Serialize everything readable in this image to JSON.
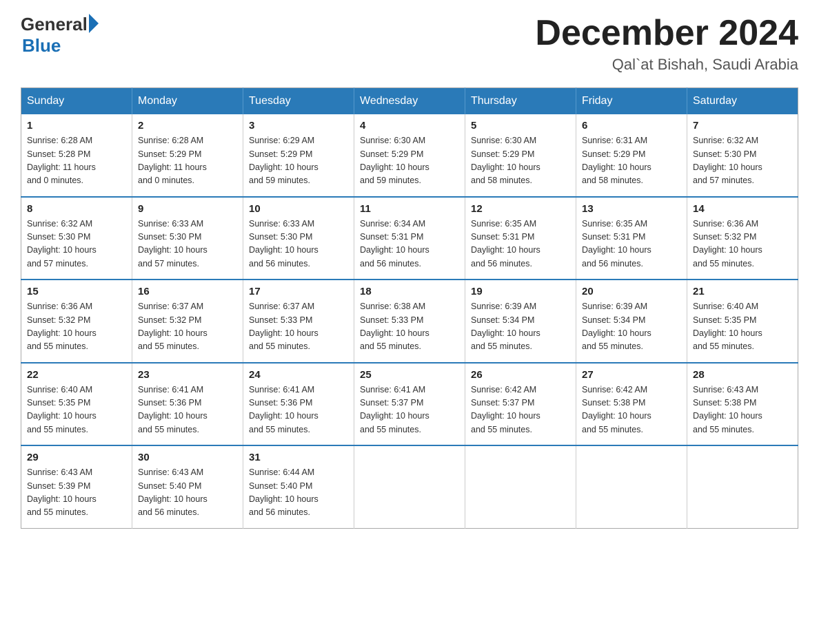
{
  "header": {
    "logo_general": "General",
    "logo_blue": "Blue",
    "month_title": "December 2024",
    "location": "Qal`at Bishah, Saudi Arabia"
  },
  "days_of_week": [
    "Sunday",
    "Monday",
    "Tuesday",
    "Wednesday",
    "Thursday",
    "Friday",
    "Saturday"
  ],
  "weeks": [
    [
      {
        "day": "1",
        "sunrise": "6:28 AM",
        "sunset": "5:28 PM",
        "daylight": "11 hours and 0 minutes."
      },
      {
        "day": "2",
        "sunrise": "6:28 AM",
        "sunset": "5:29 PM",
        "daylight": "11 hours and 0 minutes."
      },
      {
        "day": "3",
        "sunrise": "6:29 AM",
        "sunset": "5:29 PM",
        "daylight": "10 hours and 59 minutes."
      },
      {
        "day": "4",
        "sunrise": "6:30 AM",
        "sunset": "5:29 PM",
        "daylight": "10 hours and 59 minutes."
      },
      {
        "day": "5",
        "sunrise": "6:30 AM",
        "sunset": "5:29 PM",
        "daylight": "10 hours and 58 minutes."
      },
      {
        "day": "6",
        "sunrise": "6:31 AM",
        "sunset": "5:29 PM",
        "daylight": "10 hours and 58 minutes."
      },
      {
        "day": "7",
        "sunrise": "6:32 AM",
        "sunset": "5:30 PM",
        "daylight": "10 hours and 57 minutes."
      }
    ],
    [
      {
        "day": "8",
        "sunrise": "6:32 AM",
        "sunset": "5:30 PM",
        "daylight": "10 hours and 57 minutes."
      },
      {
        "day": "9",
        "sunrise": "6:33 AM",
        "sunset": "5:30 PM",
        "daylight": "10 hours and 57 minutes."
      },
      {
        "day": "10",
        "sunrise": "6:33 AM",
        "sunset": "5:30 PM",
        "daylight": "10 hours and 56 minutes."
      },
      {
        "day": "11",
        "sunrise": "6:34 AM",
        "sunset": "5:31 PM",
        "daylight": "10 hours and 56 minutes."
      },
      {
        "day": "12",
        "sunrise": "6:35 AM",
        "sunset": "5:31 PM",
        "daylight": "10 hours and 56 minutes."
      },
      {
        "day": "13",
        "sunrise": "6:35 AM",
        "sunset": "5:31 PM",
        "daylight": "10 hours and 56 minutes."
      },
      {
        "day": "14",
        "sunrise": "6:36 AM",
        "sunset": "5:32 PM",
        "daylight": "10 hours and 55 minutes."
      }
    ],
    [
      {
        "day": "15",
        "sunrise": "6:36 AM",
        "sunset": "5:32 PM",
        "daylight": "10 hours and 55 minutes."
      },
      {
        "day": "16",
        "sunrise": "6:37 AM",
        "sunset": "5:32 PM",
        "daylight": "10 hours and 55 minutes."
      },
      {
        "day": "17",
        "sunrise": "6:37 AM",
        "sunset": "5:33 PM",
        "daylight": "10 hours and 55 minutes."
      },
      {
        "day": "18",
        "sunrise": "6:38 AM",
        "sunset": "5:33 PM",
        "daylight": "10 hours and 55 minutes."
      },
      {
        "day": "19",
        "sunrise": "6:39 AM",
        "sunset": "5:34 PM",
        "daylight": "10 hours and 55 minutes."
      },
      {
        "day": "20",
        "sunrise": "6:39 AM",
        "sunset": "5:34 PM",
        "daylight": "10 hours and 55 minutes."
      },
      {
        "day": "21",
        "sunrise": "6:40 AM",
        "sunset": "5:35 PM",
        "daylight": "10 hours and 55 minutes."
      }
    ],
    [
      {
        "day": "22",
        "sunrise": "6:40 AM",
        "sunset": "5:35 PM",
        "daylight": "10 hours and 55 minutes."
      },
      {
        "day": "23",
        "sunrise": "6:41 AM",
        "sunset": "5:36 PM",
        "daylight": "10 hours and 55 minutes."
      },
      {
        "day": "24",
        "sunrise": "6:41 AM",
        "sunset": "5:36 PM",
        "daylight": "10 hours and 55 minutes."
      },
      {
        "day": "25",
        "sunrise": "6:41 AM",
        "sunset": "5:37 PM",
        "daylight": "10 hours and 55 minutes."
      },
      {
        "day": "26",
        "sunrise": "6:42 AM",
        "sunset": "5:37 PM",
        "daylight": "10 hours and 55 minutes."
      },
      {
        "day": "27",
        "sunrise": "6:42 AM",
        "sunset": "5:38 PM",
        "daylight": "10 hours and 55 minutes."
      },
      {
        "day": "28",
        "sunrise": "6:43 AM",
        "sunset": "5:38 PM",
        "daylight": "10 hours and 55 minutes."
      }
    ],
    [
      {
        "day": "29",
        "sunrise": "6:43 AM",
        "sunset": "5:39 PM",
        "daylight": "10 hours and 55 minutes."
      },
      {
        "day": "30",
        "sunrise": "6:43 AM",
        "sunset": "5:40 PM",
        "daylight": "10 hours and 56 minutes."
      },
      {
        "day": "31",
        "sunrise": "6:44 AM",
        "sunset": "5:40 PM",
        "daylight": "10 hours and 56 minutes."
      },
      null,
      null,
      null,
      null
    ]
  ],
  "labels": {
    "sunrise": "Sunrise:",
    "sunset": "Sunset:",
    "daylight": "Daylight:"
  }
}
